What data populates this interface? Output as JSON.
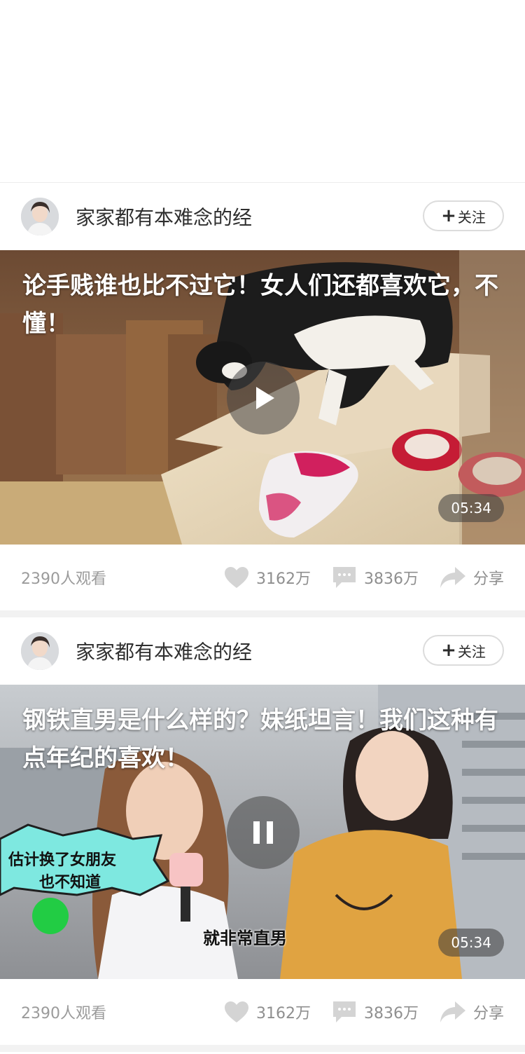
{
  "feed": {
    "cards": [
      {
        "channel_name": "家家都有本难念的经",
        "follow_label": "关注",
        "title": "论手贱谁也比不过它！女人们还都喜欢它，不懂！",
        "duration": "05:34",
        "playback_icon": "play-icon",
        "views": "2390人观看",
        "likes": "3162万",
        "comments": "3836万",
        "share_label": "分享"
      },
      {
        "channel_name": "家家都有本难念的经",
        "follow_label": "关注",
        "title": "钢铁直男是什么样的？妹纸坦言！我们这种有点年纪的喜欢！",
        "duration": "05:34",
        "playback_icon": "pause-icon",
        "views": "2390人观看",
        "likes": "3162万",
        "comments": "3836万",
        "share_label": "分享",
        "in_video_captions": [
          "估计换了女朋友",
          "也不知道",
          "就非常直男"
        ]
      }
    ]
  },
  "colors": {
    "text_primary": "#2f2f2f",
    "text_secondary": "#9b9b9b",
    "icon_gray": "#cfcfcf",
    "divider": "#f2f2f2"
  }
}
